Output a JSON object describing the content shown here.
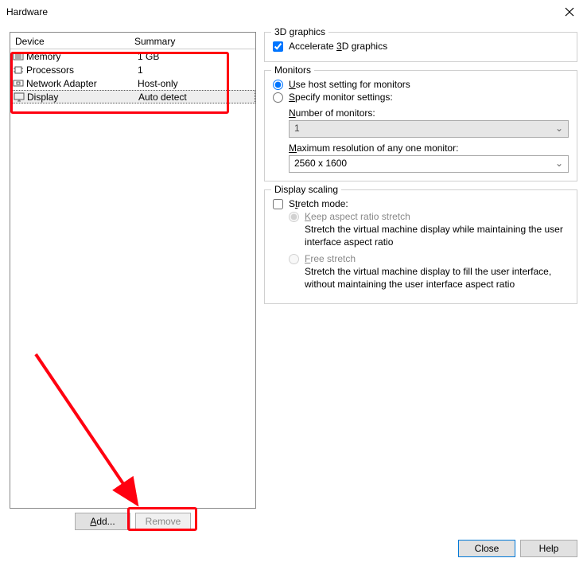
{
  "window": {
    "title": "Hardware"
  },
  "deviceList": {
    "headers": {
      "device": "Device",
      "summary": "Summary"
    },
    "rows": [
      {
        "icon": "memory-icon",
        "name": "Memory",
        "summary": "1 GB"
      },
      {
        "icon": "processors-icon",
        "name": "Processors",
        "summary": "1"
      },
      {
        "icon": "network-adapter-icon",
        "name": "Network Adapter",
        "summary": "Host-only"
      },
      {
        "icon": "display-icon",
        "name": "Display",
        "summary": "Auto detect"
      }
    ],
    "buttons": {
      "add": "Add...",
      "remove": "Remove"
    }
  },
  "graphics3d": {
    "legend": "3D graphics",
    "accelerate": {
      "prefix": "Accelerate ",
      "u": "3",
      "suffix": "D graphics",
      "checked": true
    }
  },
  "monitors": {
    "legend": "Monitors",
    "useHost": {
      "u": "U",
      "suffix": "se host setting for monitors"
    },
    "specify": {
      "u": "S",
      "suffix": "pecify monitor settings:"
    },
    "selected": "useHost",
    "numberLabel": {
      "u": "N",
      "suffix": "umber of monitors:"
    },
    "numberValue": "1",
    "maxResLabel": {
      "u": "M",
      "suffix": "aximum resolution of any one monitor:"
    },
    "maxResValue": "2560 x 1600"
  },
  "scaling": {
    "legend": "Display scaling",
    "stretchMode": {
      "prefix": "S",
      "u": "t",
      "suffix": "retch mode:",
      "checked": false
    },
    "keep": {
      "u": "K",
      "suffix": "eep aspect ratio stretch",
      "desc": "Stretch the virtual machine display while maintaining the user interface aspect ratio"
    },
    "free": {
      "u": "F",
      "suffix": "ree stretch",
      "desc": "Stretch the virtual machine display to fill the user interface, without maintaining the user interface aspect ratio"
    }
  },
  "bottom": {
    "close": "Close",
    "help": "Help"
  }
}
